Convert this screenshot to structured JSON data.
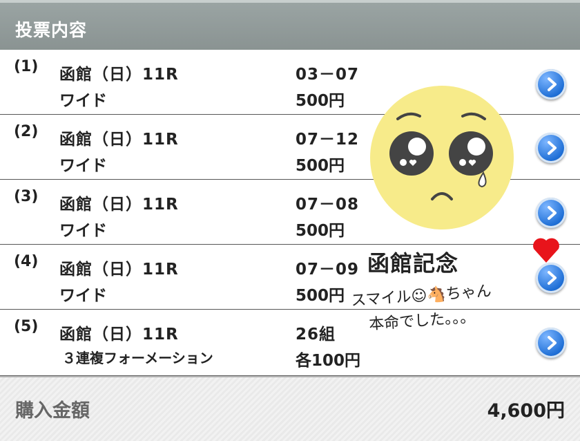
{
  "header": {
    "title": "投票内容"
  },
  "bets": [
    {
      "num": "(1)",
      "race": "函館（日）11R",
      "type": "ワイド",
      "combo": "03－07",
      "amount": "500円"
    },
    {
      "num": "(2)",
      "race": "函館（日）11R",
      "type": "ワイド",
      "combo": "07－12",
      "amount": "500円"
    },
    {
      "num": "(3)",
      "race": "函館（日）11R",
      "type": "ワイド",
      "combo": "07－08",
      "amount": "500円"
    },
    {
      "num": "(4)",
      "race": "函館（日）11R",
      "type": "ワイド",
      "combo": "07－09",
      "amount": "500円"
    },
    {
      "num": "(5)",
      "race": "函館（日）11R",
      "type": "３連複フォーメーション",
      "combo": "26組",
      "amount": "各100円"
    }
  ],
  "footer": {
    "label": "購入金額",
    "total": "4,600円"
  },
  "overlay": {
    "line1": "函館記念",
    "line2": "スマイル☺🐴ちゃん",
    "line3": "本命でした。。。",
    "sticker_icon": "pleading-face-icon",
    "heart_color": "#e8141b",
    "sticker_color": "#f7eb8a"
  },
  "colors": {
    "header_bg": "#8f9897",
    "arrow_blue": "#1f6fd6"
  }
}
